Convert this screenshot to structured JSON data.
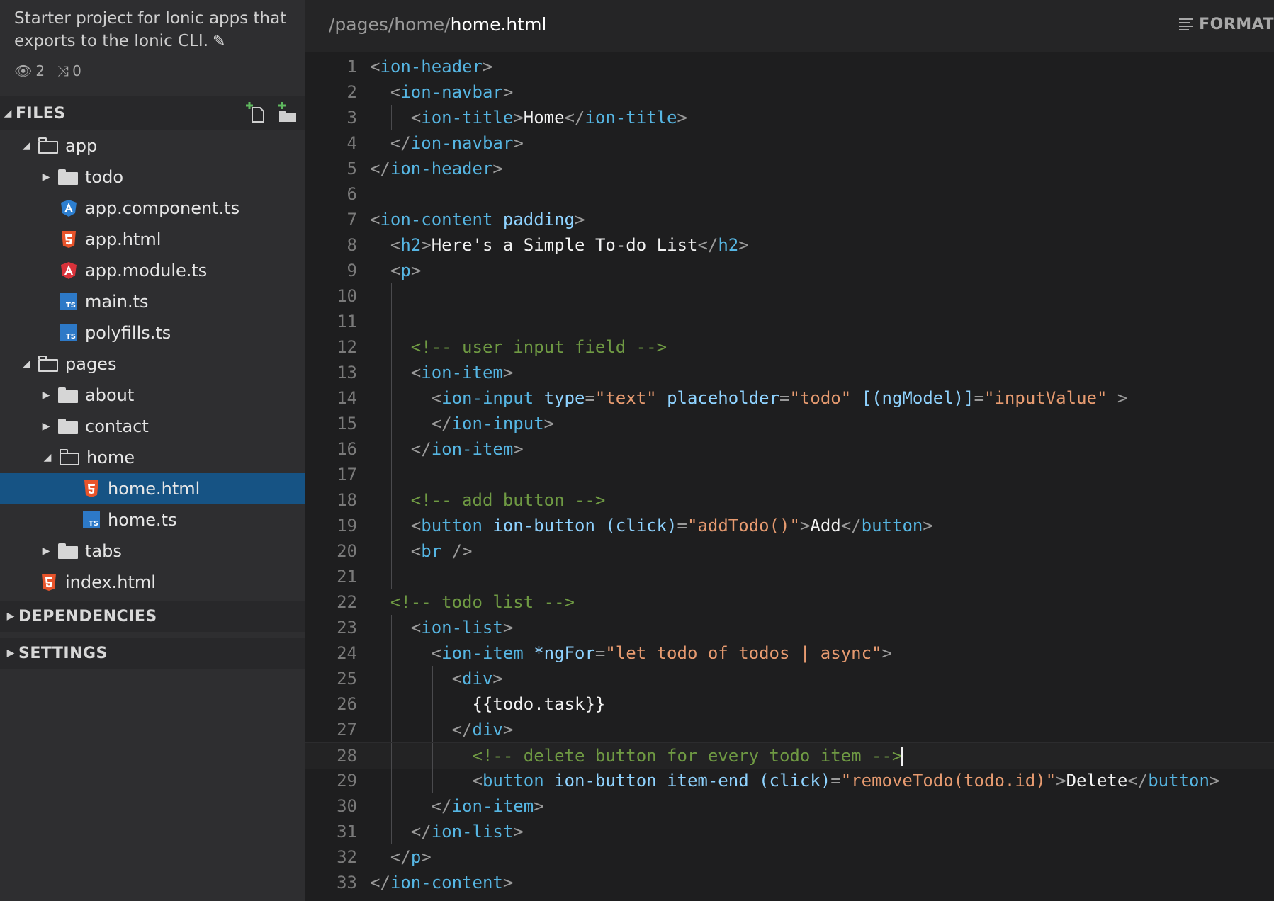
{
  "sidebar": {
    "project_desc": "Starter project for Ionic apps that exports to the Ionic CLI.",
    "watchers": "2",
    "forks": "0",
    "files_label": "FILES",
    "dependencies_label": "DEPENDENCIES",
    "settings_label": "SETTINGS"
  },
  "tree": [
    {
      "label": "app",
      "kind": "folder-open"
    },
    {
      "label": "todo",
      "kind": "folder"
    },
    {
      "label": "app.component.ts",
      "kind": "angular-blue"
    },
    {
      "label": "app.html",
      "kind": "html"
    },
    {
      "label": "app.module.ts",
      "kind": "angular-red"
    },
    {
      "label": "main.ts",
      "kind": "ts"
    },
    {
      "label": "polyfills.ts",
      "kind": "ts"
    },
    {
      "label": "pages",
      "kind": "folder-open"
    },
    {
      "label": "about",
      "kind": "folder"
    },
    {
      "label": "contact",
      "kind": "folder"
    },
    {
      "label": "home",
      "kind": "folder-open"
    },
    {
      "label": "home.html",
      "kind": "html"
    },
    {
      "label": "home.ts",
      "kind": "ts"
    },
    {
      "label": "tabs",
      "kind": "folder"
    },
    {
      "label": "index.html",
      "kind": "html"
    }
  ],
  "editor": {
    "path_prefix": "/pages/home/",
    "path_current": "home.html",
    "format_label": "FORMAT"
  },
  "code_lines": [
    "<ion-header>",
    "  <ion-navbar>",
    "    <ion-title>Home</ion-title>",
    "  </ion-navbar>",
    "</ion-header>",
    "",
    "<ion-content padding>",
    "  <h2>Here's a Simple To-do List</h2>",
    "  <p>",
    "",
    "",
    "    <!-- user input field -->",
    "    <ion-item>",
    "      <ion-input type=\"text\" placeholder=\"todo\" [(ngModel)]=\"inputValue\" >",
    "      </ion-input>",
    "    </ion-item>",
    "",
    "    <!-- add button -->",
    "    <button ion-button (click)=\"addTodo()\">Add</button>",
    "    <br />",
    "",
    "  <!-- todo list -->",
    "    <ion-list>",
    "      <ion-item *ngFor=\"let todo of todos | async\">",
    "        <div>",
    "          {{todo.task}}",
    "        </div>",
    "          <!-- delete button for every todo item -->",
    "          <button ion-button item-end (click)=\"removeTodo(todo.id)\">Delete</button>",
    "      </ion-item>",
    "    </ion-list>",
    "  </p>",
    "</ion-content>"
  ]
}
